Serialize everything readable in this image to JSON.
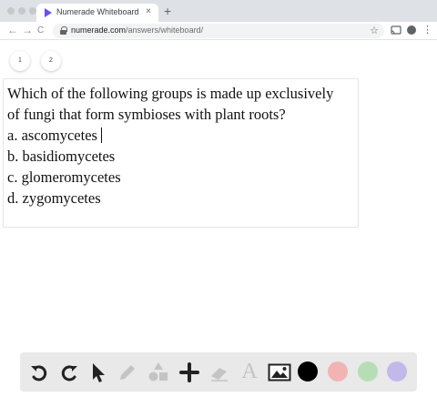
{
  "browser": {
    "tab_title": "Numerade Whiteboard",
    "tab_close": "×",
    "new_tab": "+",
    "url_host": "numerade.com",
    "url_path": "/answers/whiteboard/",
    "star": "☆",
    "back": "←",
    "forward": "→",
    "reload": "C"
  },
  "pages": [
    "1",
    "2"
  ],
  "question": {
    "line1": "Which of the following groups is made up exclusively",
    "line2": "of fungi that form symbioses with plant roots?",
    "options": [
      "a. ascomycetes",
      "b. basidiomycetes",
      "c. glomeromycetes",
      "d. zygomycetes"
    ]
  },
  "toolbar": {
    "icons": [
      "undo-icon",
      "redo-icon",
      "cursor-icon",
      "pencil-icon",
      "shapes-icon",
      "plus-icon",
      "eraser-icon",
      "text-icon",
      "image-icon"
    ],
    "text_tool_label": "A",
    "colors": [
      "#000000",
      "#f2b3b3",
      "#b7ddb7",
      "#c3b8ea"
    ]
  }
}
